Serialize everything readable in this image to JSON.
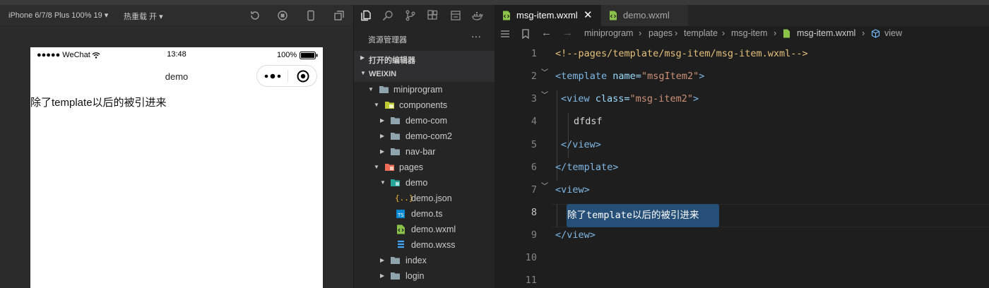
{
  "simulator": {
    "device": "iPhone 6/7/8 Plus 100% 19",
    "hot_reload": "热重载 开",
    "status": {
      "signal": "●●●●● WeChat",
      "time": "13:48",
      "battery": "100%"
    },
    "nav_title": "demo",
    "page_text": "除了template以后的被引进来"
  },
  "explorer": {
    "title": "资源管理器",
    "more": "···",
    "open_editors": "打开的编辑器",
    "workspace": "WEIXIN",
    "tree": [
      {
        "label": "miniprogram",
        "icon": "folder-open-icon"
      },
      {
        "label": "components",
        "icon": "components-folder-icon"
      },
      {
        "label": "demo-com",
        "icon": "folder-icon"
      },
      {
        "label": "demo-com2",
        "icon": "folder-icon"
      },
      {
        "label": "nav-bar",
        "icon": "folder-icon"
      },
      {
        "label": "pages",
        "icon": "pages-folder-icon"
      },
      {
        "label": "demo",
        "icon": "folder-open-icon"
      },
      {
        "label": "demo.json",
        "icon": "json-file-icon"
      },
      {
        "label": "demo.ts",
        "icon": "ts-file-icon"
      },
      {
        "label": "demo.wxml",
        "icon": "wxml-file-icon"
      },
      {
        "label": "demo.wxss",
        "icon": "wxss-file-icon"
      },
      {
        "label": "index",
        "icon": "folder-icon"
      },
      {
        "label": "login",
        "icon": "folder-icon"
      }
    ]
  },
  "editor": {
    "tabs": [
      {
        "label": "msg-item.wxml",
        "active": true
      },
      {
        "label": "demo.wxml",
        "active": false
      }
    ],
    "breadcrumbs": [
      "miniprogram",
      "pages",
      "template",
      "msg-item",
      "msg-item.wxml",
      "view"
    ],
    "line_numbers": [
      "1",
      "2",
      "3",
      "4",
      "5",
      "6",
      "7",
      "8",
      "9",
      "10",
      "11"
    ],
    "code": {
      "l1": "<!--pages/template/msg-item/msg-item.wxml-->",
      "l2_open": "<template",
      "l2_attr": " name=",
      "l2_val": "\"msgItem2\"",
      "l2_close": ">",
      "l3_open": "<view",
      "l3_attr": " class=",
      "l3_val": "\"msg-item2\"",
      "l3_close": ">",
      "l4": "dfdsf",
      "l5": "</view>",
      "l6": "</template>",
      "l7": "<view>",
      "l8": "除了template以后的被引进来",
      "l9": "</view>"
    }
  },
  "colors": {
    "accent": "#264f78",
    "comment": "#e5c07b",
    "tag": "#7fb8e6",
    "string": "#ce9178"
  }
}
